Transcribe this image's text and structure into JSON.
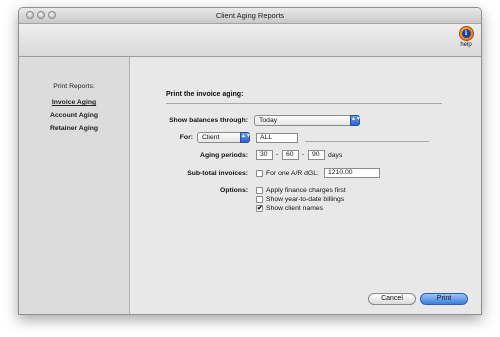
{
  "window": {
    "title": "Client Aging Reports"
  },
  "toolbar": {
    "help_label": "help",
    "help_glyph": "i"
  },
  "sidebar": {
    "heading": "Print Reports:",
    "items": [
      {
        "label": "Invoice Aging",
        "active": true
      },
      {
        "label": "Account Aging",
        "active": false
      },
      {
        "label": "Retainer Aging",
        "active": false
      }
    ]
  },
  "main": {
    "section_title": "Print the invoice aging:",
    "show_balances": {
      "label": "Show balances through:",
      "value": "Today"
    },
    "for": {
      "label": "For:",
      "selected": "Client",
      "value": "ALL"
    },
    "aging_periods": {
      "label": "Aging periods:",
      "p1": "30",
      "p2": "60",
      "p3": "90",
      "separator": "-",
      "unit": "days"
    },
    "subtotal": {
      "label": "Sub-total invoices:",
      "checkbox_label": "For one A/R dGL:",
      "checked": false,
      "value": "1210.00"
    },
    "options": {
      "label": "Options:",
      "items": [
        {
          "label": "Apply finance charges first",
          "checked": false
        },
        {
          "label": "Show year-to-date billings",
          "checked": false
        },
        {
          "label": "Show client names",
          "checked": true
        }
      ]
    }
  },
  "buttons": {
    "cancel": "Cancel",
    "print": "Print"
  },
  "icons": {
    "checkmark": "✔",
    "popup_arrows": "▲▼"
  },
  "colors": {
    "accent": "#3d7fdc",
    "help_orange": "#e66a00"
  }
}
